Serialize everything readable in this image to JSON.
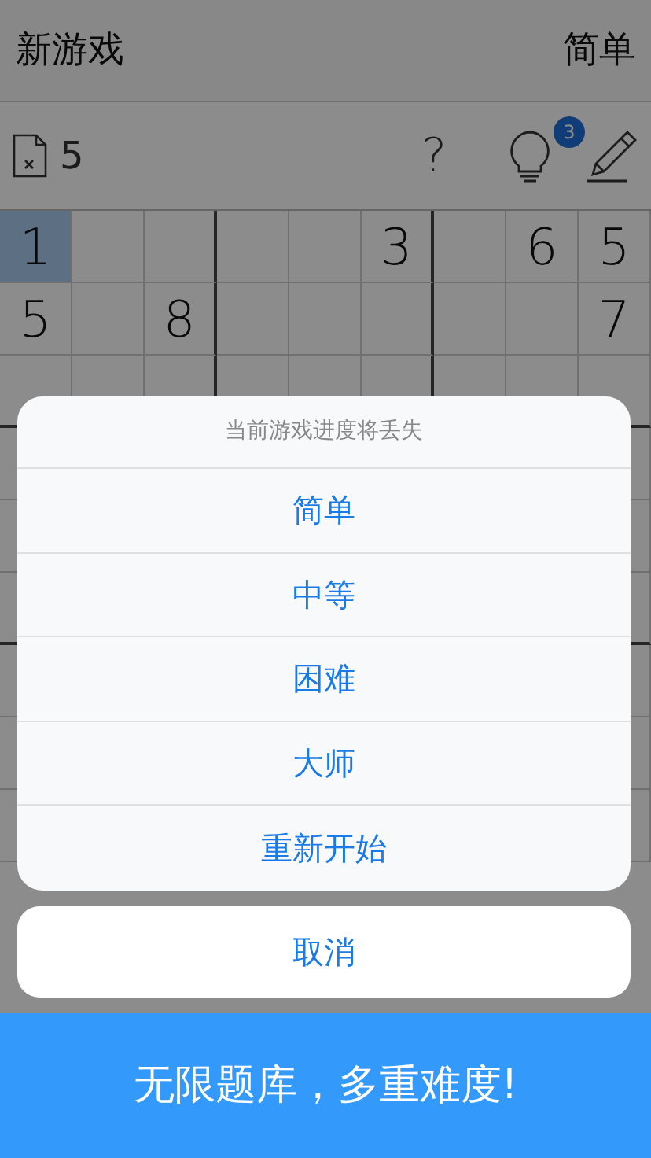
{
  "header": {
    "title": "新游戏",
    "difficulty": "简单"
  },
  "toolbar": {
    "mistakes": "5",
    "help": "?",
    "hint_badge": "3"
  },
  "grid": {
    "rows": [
      [
        {
          "value": "1",
          "selected": true
        },
        {
          "selected": false
        },
        {
          "selected": false
        },
        {
          "selected": false
        },
        {
          "selected": false
        },
        {
          "value": "3",
          "selected": false
        },
        {
          "selected": false
        },
        {
          "value": "6",
          "selected": false
        },
        {
          "value": "5",
          "selected": false
        }
      ],
      [
        {
          "value": "5",
          "selected": false
        },
        {
          "selected": false
        },
        {
          "value": "8",
          "selected": false
        },
        {
          "selected": false
        },
        {
          "selected": false
        },
        {
          "selected": false
        },
        {
          "selected": false
        },
        {
          "selected": false
        },
        {
          "value": "7",
          "selected": false
        }
      ]
    ]
  },
  "action_sheet": {
    "message": "当前游戏进度将丢失",
    "options": [
      "简单",
      "中等",
      "困难",
      "大师",
      "重新开始"
    ],
    "cancel": "取消"
  },
  "banner": "无限题库，多重难度!"
}
